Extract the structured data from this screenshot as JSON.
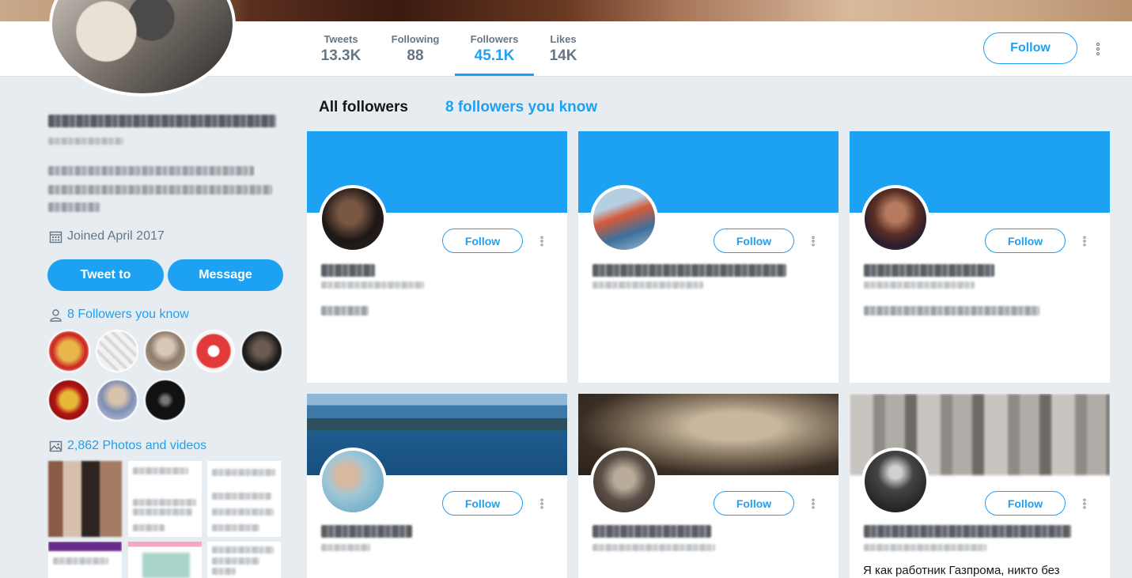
{
  "nav": {
    "stats": [
      {
        "label": "Tweets",
        "value": "13.3K"
      },
      {
        "label": "Following",
        "value": "88"
      },
      {
        "label": "Followers",
        "value": "45.1K"
      },
      {
        "label": "Likes",
        "value": "14K"
      }
    ],
    "follow_label": "Follow"
  },
  "profile": {
    "joined": "Joined April 2017",
    "tweet_to_label": "Tweet to",
    "message_label": "Message",
    "followers_you_know": "8 Followers you know",
    "photos_videos": "2,862 Photos and videos"
  },
  "tabs": {
    "all": "All followers",
    "know": "8 followers you know"
  },
  "cards": [
    {
      "follow_label": "Follow"
    },
    {
      "follow_label": "Follow"
    },
    {
      "follow_label": "Follow"
    },
    {
      "follow_label": "Follow"
    },
    {
      "follow_label": "Follow"
    },
    {
      "follow_label": "Follow",
      "bio": "Я как работник Газпрома, никто без"
    }
  ],
  "colors": {
    "accent": "#1da1f2",
    "background": "#e6ecf0",
    "muted": "#657786"
  },
  "icons": [
    "calendar-icon",
    "person-icon",
    "image-icon",
    "more-icon"
  ]
}
